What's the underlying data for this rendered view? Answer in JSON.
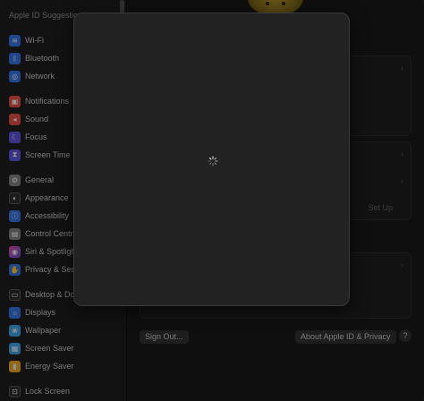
{
  "sidebar": {
    "header": "Apple ID Suggestions",
    "items": [
      {
        "label": "Wi-Fi",
        "icon": "wifi-icon",
        "color": "#2f6fd6",
        "glyph": "≋"
      },
      {
        "label": "Bluetooth",
        "icon": "bluetooth-icon",
        "color": "#2f6fd6",
        "glyph": "ᛒ"
      },
      {
        "label": "Network",
        "icon": "globe-icon",
        "color": "#2f6fd6",
        "glyph": "◎"
      },
      {
        "label": "Notifications",
        "icon": "bell-icon",
        "color": "#d64a3c",
        "glyph": "▣"
      },
      {
        "label": "Sound",
        "icon": "speaker-icon",
        "color": "#d64a3c",
        "glyph": "◂"
      },
      {
        "label": "Focus",
        "icon": "moon-icon",
        "color": "#5a4fd0",
        "glyph": "☾"
      },
      {
        "label": "Screen Time",
        "icon": "hourglass-icon",
        "color": "#5a4fd0",
        "glyph": "⧗"
      },
      {
        "label": "General",
        "icon": "gear-icon",
        "color": "#7a7a7a",
        "glyph": "⚙"
      },
      {
        "label": "Appearance",
        "icon": "appearance-icon",
        "color": "#2a2a2a",
        "glyph": "◐"
      },
      {
        "label": "Accessibility",
        "icon": "accessibility-icon",
        "color": "#2f6fd6",
        "glyph": "ⓘ"
      },
      {
        "label": "Control Centre",
        "icon": "control-centre-icon",
        "color": "#7a7a7a",
        "glyph": "▤"
      },
      {
        "label": "Siri & Spotlight",
        "icon": "siri-icon",
        "color": "#5a4fd0",
        "glyph": "◉"
      },
      {
        "label": "Privacy & Security",
        "icon": "hand-icon",
        "color": "#2f6fd6",
        "glyph": "✋"
      },
      {
        "label": "Desktop & Dock",
        "icon": "dock-icon",
        "color": "#2a2a2a",
        "glyph": "▭"
      },
      {
        "label": "Displays",
        "icon": "display-icon",
        "color": "#2f6fd6",
        "glyph": "☼"
      },
      {
        "label": "Wallpaper",
        "icon": "wallpaper-icon",
        "color": "#3a9ad9",
        "glyph": "❀"
      },
      {
        "label": "Screen Saver",
        "icon": "screensaver-icon",
        "color": "#3a9ad9",
        "glyph": "▦"
      },
      {
        "label": "Energy Saver",
        "icon": "battery-icon",
        "color": "#e0a020",
        "glyph": "▮"
      },
      {
        "label": "Lock Screen",
        "icon": "lock-icon",
        "color": "#2a2a2a",
        "glyph": "⊡"
      }
    ]
  },
  "main": {
    "setup_label": "Set Up",
    "sign_out_label": "Sign Out...",
    "about_label": "About Apple ID & Privacy",
    "help_label": "?"
  },
  "sheet": {
    "loading_icon": "spinner-icon"
  }
}
